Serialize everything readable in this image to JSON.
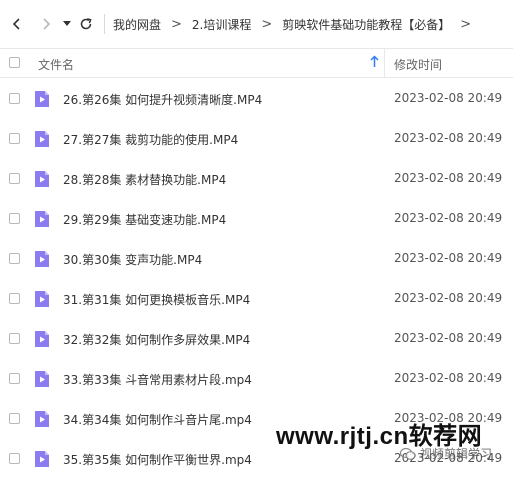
{
  "toolbar": {
    "back_icon": "chevron-left-icon",
    "forward_icon": "chevron-right-icon",
    "dropdown_icon": "caret-down-icon",
    "refresh_icon": "refresh-icon",
    "breadcrumbs": [
      "我的网盘",
      "2.培训课程",
      "剪映软件基础功能教程【必备】"
    ],
    "separator": ">"
  },
  "header": {
    "name_label": "文件名",
    "sort_icon": "arrow-up-icon",
    "time_label": "修改时间"
  },
  "files": [
    {
      "name": "26.第26集 如何提升视频清晰度.MP4",
      "modified": "2023-02-08 20:49"
    },
    {
      "name": "27.第27集 裁剪功能的使用.MP4",
      "modified": "2023-02-08 20:49"
    },
    {
      "name": "28.第28集 素材替换功能.MP4",
      "modified": "2023-02-08 20:49"
    },
    {
      "name": "29.第29集 基础变速功能.MP4",
      "modified": "2023-02-08 20:49"
    },
    {
      "name": "30.第30集 变声功能.MP4",
      "modified": "2023-02-08 20:49"
    },
    {
      "name": "31.第31集 如何更换模板音乐.MP4",
      "modified": "2023-02-08 20:49"
    },
    {
      "name": "32.第32集 如何制作多屏效果.MP4",
      "modified": "2023-02-08 20:49"
    },
    {
      "name": "33.第33集 斗音常用素材片段.mp4",
      "modified": "2023-02-08 20:49"
    },
    {
      "name": "34.第34集 如何制作斗音片尾.mp4",
      "modified": "2023-02-08 20:49"
    },
    {
      "name": "35.第35集 如何制作平衡世界.mp4",
      "modified": "2023-02-08 20:49"
    }
  ],
  "watermark": {
    "url": "www.rjtj.cn软荐网",
    "sub": "视频剪辑学习"
  },
  "colors": {
    "video_icon": "#8b7cf0",
    "video_icon_fold": "#c7bff8",
    "sort_arrow": "#2e7cf6"
  }
}
